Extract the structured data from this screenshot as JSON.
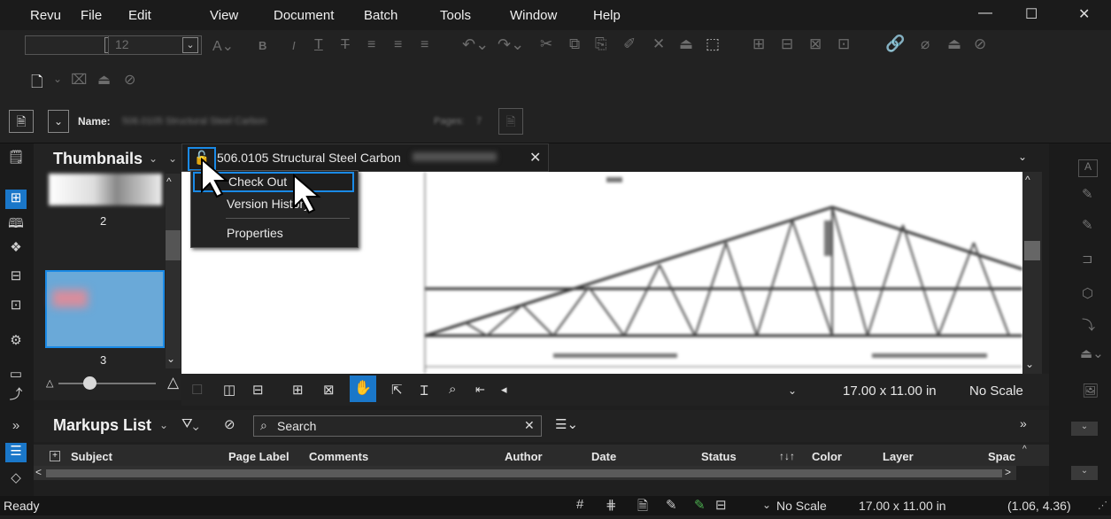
{
  "menubar": {
    "items": [
      "Revu",
      "File",
      "Edit",
      "View",
      "Document",
      "Batch",
      "Tools",
      "Window",
      "Help"
    ]
  },
  "window_controls": {
    "minimize": "—",
    "maximize": "☐",
    "close": "✕"
  },
  "toolbar": {
    "font_size": "12"
  },
  "doc_info": {
    "name_label": "Name:",
    "name_value": "506.0105 Structural Steel Carbon",
    "pages_label": "Pages:",
    "pages_value": "7"
  },
  "thumbnails": {
    "title": "Thumbnails",
    "page_numbers": [
      "2",
      "3"
    ]
  },
  "tab": {
    "title": "506.0105 Structural Steel Carbon"
  },
  "context_menu": {
    "items": [
      "Check Out",
      "Version History",
      "Properties"
    ]
  },
  "doc_bottom": {
    "page_size": "17.00 x 11.00 in",
    "scale": "No Scale"
  },
  "markups": {
    "title": "Markups List",
    "search_placeholder": "Search",
    "columns": [
      "Subject",
      "Page Label",
      "Comments",
      "Author",
      "Date",
      "Status",
      "Color",
      "Layer",
      "Spac"
    ]
  },
  "status": {
    "ready": "Ready",
    "scale": "No Scale",
    "size": "17.00 x 11.00 in",
    "coords": "(1.06, 4.36)"
  }
}
